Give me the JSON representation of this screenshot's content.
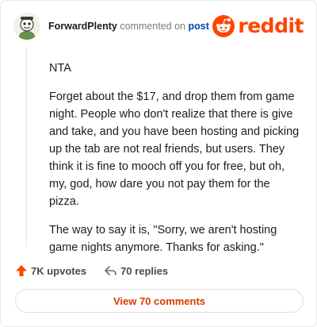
{
  "comment": {
    "username": "ForwardPlenty",
    "action_text": "commented on",
    "target_link": "post",
    "paragraphs": [
      "NTA",
      "Forget about the $17, and drop them from game night. People who don't realize that there is give and take, and you have been hosting and picking up the tab are not real friends, but users. They think it is fine to mooch off you for free, but oh, my, god, how dare you not pay them for the pizza.",
      "The way to say it is, \"Sorry, we aren't hosting game nights anymore. Thanks for asking.\""
    ]
  },
  "brand": {
    "logo_text": "reddit",
    "color": "#ff4500"
  },
  "actions": {
    "upvotes": "7K upvotes",
    "replies": "70 replies"
  },
  "footer": {
    "view_comments_label": "View 70 comments"
  },
  "colors": {
    "accent_link": "#0045ac",
    "button_text": "#d93a00",
    "upvote_icon": "#ff4500"
  }
}
